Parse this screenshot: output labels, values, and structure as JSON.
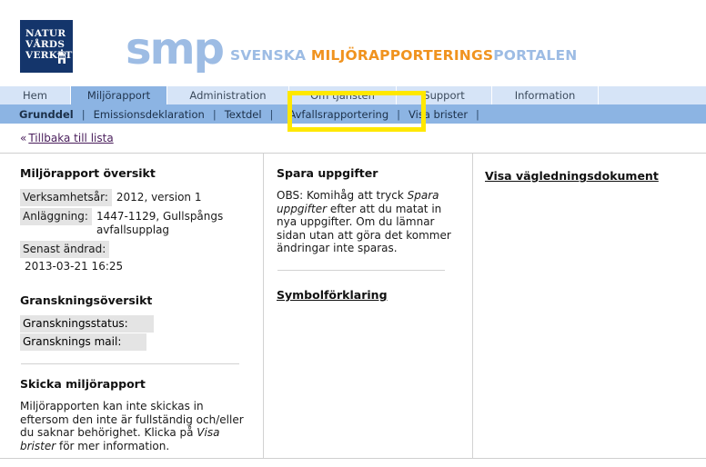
{
  "brand": {
    "agency_line1": "NATUR",
    "agency_line2": "VÅRDS",
    "agency_line3": "VERKET",
    "smp": "smp",
    "tagline_1": "SVENSKA ",
    "tagline_2": "MILJÖRAPPORTERINGS",
    "tagline_3": "PORTALEN",
    "color_blue": "#9dbce4",
    "color_orange": "#f0931f"
  },
  "topnav": {
    "items": [
      {
        "label": "Hem",
        "active": false
      },
      {
        "label": "Miljörapport",
        "active": true
      },
      {
        "label": "Administration",
        "active": false
      },
      {
        "label": "Om tjänsten",
        "active": false
      },
      {
        "label": "Support",
        "active": false
      },
      {
        "label": "Information",
        "active": false
      }
    ]
  },
  "subnav": {
    "items": [
      {
        "label": "Grunddel",
        "active": true
      },
      {
        "label": "Emissionsdeklaration",
        "active": false
      },
      {
        "label": "Textdel",
        "active": false
      },
      {
        "label": "Avfallsrapportering",
        "active": false
      },
      {
        "label": "Visa brister",
        "active": false
      }
    ],
    "separator": "|",
    "highlighted_item": "Avfallsrapportering",
    "highlight_color": "#ffe800"
  },
  "backlink": {
    "chevron": "«",
    "label": "Tillbaka till lista"
  },
  "left_column": {
    "overview_title": "Miljörapport översikt",
    "rows": [
      {
        "label": "Verksamhetsår:",
        "value": "2012, version 1"
      },
      {
        "label": "Anläggning:",
        "value": "1447-1129, Gullspångs avfallsupplag"
      },
      {
        "label": "Senast ändrad:",
        "value": "2013-03-21 16:25"
      }
    ],
    "review_title": "Granskningsöversikt",
    "review_rows": [
      {
        "label": "Granskningsstatus:",
        "value": ""
      },
      {
        "label": "Gransknings mail:",
        "value": ""
      }
    ],
    "send_title": "Skicka miljörapport",
    "send_text_1": "Miljörapporten kan inte skickas in eftersom den inte är fullständig och/eller du saknar behörighet. Klicka på ",
    "send_text_italic": "Visa brister",
    "send_text_2": " för mer information."
  },
  "middle_column": {
    "save_title": "Spara uppgifter",
    "save_text_1": "OBS: Komihåg att tryck ",
    "save_text_italic": "Spara uppgifter",
    "save_text_2": " efter att du matat in nya uppgifter. Om du lämnar sidan utan att göra det kommer ändringar inte sparas.",
    "symbol_link": "Symbolförklaring"
  },
  "right_column": {
    "guidance_link": "Visa vägledningsdokument"
  }
}
